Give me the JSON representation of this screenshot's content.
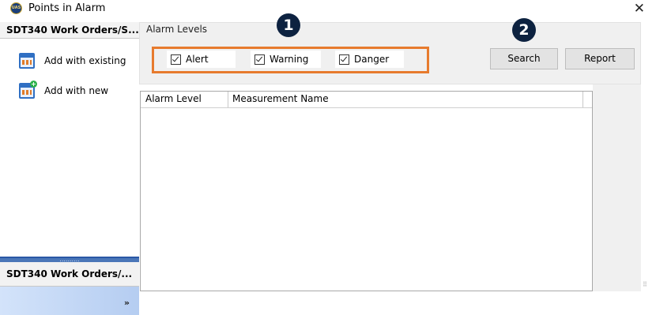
{
  "window": {
    "title": "Points in Alarm",
    "icon_text": "UAS",
    "icon": "app-logo-icon",
    "close_glyph": "✕"
  },
  "nav": {
    "header": "SDT340 Work Orders/S...",
    "items": [
      {
        "label": "Add with existing",
        "icon": "calendar-icon"
      },
      {
        "label": "Add with new",
        "icon": "calendar-add-icon"
      }
    ],
    "footer": "SDT340 Work Orders/...",
    "overflow_glyph": "»"
  },
  "alarm_levels": {
    "label": "Alarm Levels",
    "options": [
      {
        "label": "Alert",
        "checked": true
      },
      {
        "label": "Warning",
        "checked": true
      },
      {
        "label": "Danger",
        "checked": true
      }
    ],
    "highlight_color": "#e77b2e"
  },
  "buttons": {
    "search": "Search",
    "report": "Report"
  },
  "callouts": [
    "1",
    "2"
  ],
  "grid": {
    "columns": [
      "Alarm Level",
      "Measurement Name"
    ],
    "rows": []
  }
}
